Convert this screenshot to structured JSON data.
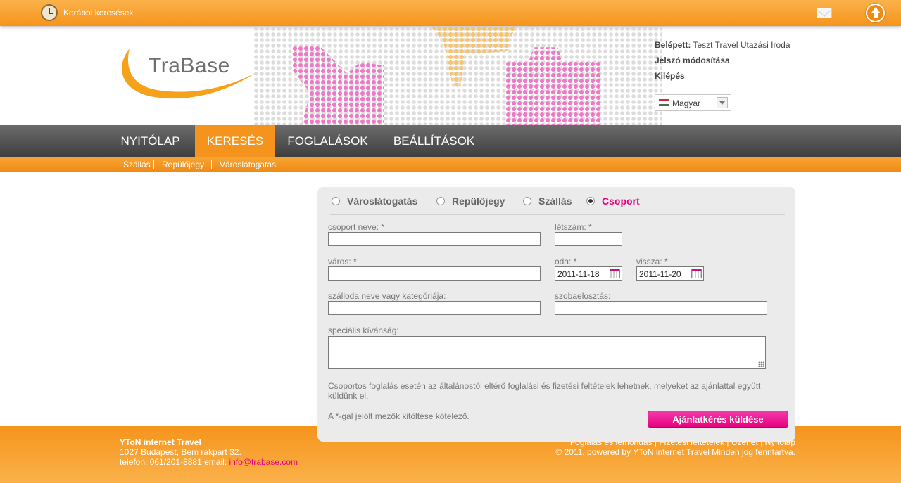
{
  "topbar": {
    "previous_searches_label": "Korábbi keresések"
  },
  "logo": {
    "text": "TraBase"
  },
  "user": {
    "logged_in_label": "Belépett:",
    "logged_in_name": "Teszt Travel Utazási Iroda",
    "change_password": "Jelszó módosítása",
    "logout": "Kilépés",
    "language": "Magyar"
  },
  "nav": {
    "items": [
      {
        "label": "NYITÓLAP"
      },
      {
        "label": "KERESÉS"
      },
      {
        "label": "FOGLALÁSOK"
      },
      {
        "label": "BEÁLLÍTÁSOK"
      }
    ],
    "active": "KERESÉS"
  },
  "subnav": {
    "items": [
      {
        "label": "Szállás"
      },
      {
        "label": "Repülőjegy"
      },
      {
        "label": "Városlátogatás"
      }
    ]
  },
  "form": {
    "types": [
      {
        "label": "Városlátogatás",
        "checked": false
      },
      {
        "label": "Repülőjegy",
        "checked": false
      },
      {
        "label": "Szállás",
        "checked": false
      },
      {
        "label": "Csoport",
        "checked": true
      }
    ],
    "fields": {
      "group_name": {
        "label": "csoport neve: *",
        "value": ""
      },
      "headcount": {
        "label": "létszám: *",
        "value": ""
      },
      "city": {
        "label": "város: *",
        "value": ""
      },
      "depart": {
        "label": "oda: *",
        "value": "2011-11-18"
      },
      "return": {
        "label": "vissza: *",
        "value": "2011-11-20"
      },
      "hotel": {
        "label": "szálloda neve vagy kategóriája:",
        "value": ""
      },
      "rooms": {
        "label": "szobaelosztás:",
        "value": ""
      },
      "special": {
        "label": "speciális kívánság:",
        "value": ""
      }
    },
    "info_text": "Csoportos foglalás esetén az általánostól eltérő foglalási és fizetési feltételek lehetnek, melyeket az ajánlattal együtt küldünk el.",
    "required_note": "A *-gal jelölt mezők kitöltése kötelező.",
    "submit_label": "Ajánlatkérés küldése"
  },
  "footer": {
    "company": "YToN internet Travel",
    "address": "1027 Budapest, Bem rakpart 32.",
    "phone_prefix": "telefon: 061/201-8881 email: ",
    "email": "info@trabase.com",
    "links": "Foglalás és lemondás | Fizetési feltételek | Üzenet | Nyitólap",
    "copyright": "© 2011. powered by YToN internet Travel Minden jog fenntartva."
  },
  "colors": {
    "accent_orange": "#f5941c",
    "accent_pink": "#e6007e",
    "nav_gray": "#4f4f4f"
  }
}
